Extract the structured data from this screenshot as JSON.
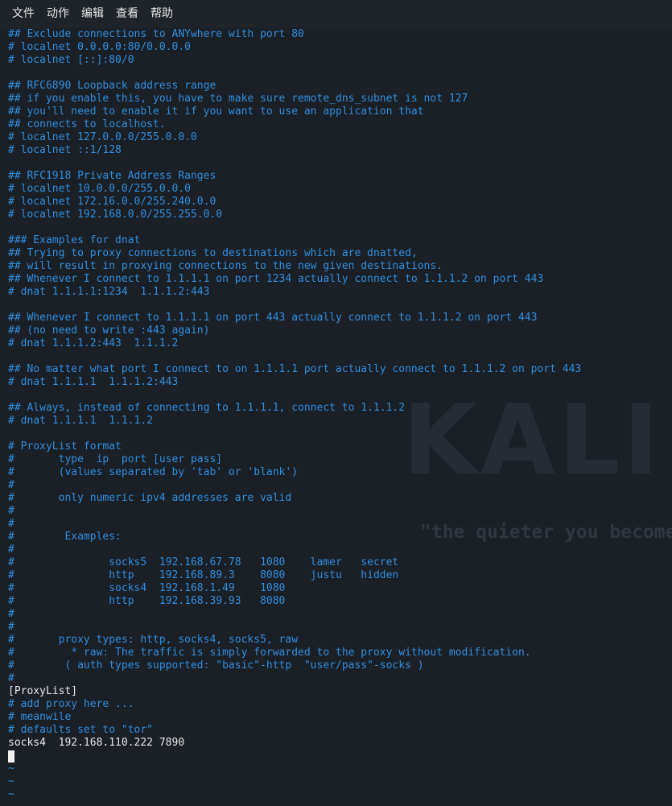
{
  "menu": [
    "文件",
    "动作",
    "编辑",
    "查看",
    "帮助"
  ],
  "wallpaper": {
    "logo_text": "KALI",
    "quote": "\"the quieter you become\""
  },
  "lines": [
    {
      "text": "## Exclude connections to ANYwhere with port 80",
      "style": "comment"
    },
    {
      "text": "# localnet 0.0.0.0:80/0.0.0.0",
      "style": "comment"
    },
    {
      "text": "# localnet [::]:80/0",
      "style": "comment"
    },
    {
      "text": "",
      "style": "comment"
    },
    {
      "text": "## RFC6890 Loopback address range",
      "style": "comment"
    },
    {
      "text": "## if you enable this, you have to make sure remote_dns_subnet is not 127",
      "style": "comment"
    },
    {
      "text": "## you'll need to enable it if you want to use an application that",
      "style": "comment"
    },
    {
      "text": "## connects to localhost.",
      "style": "comment"
    },
    {
      "text": "# localnet 127.0.0.0/255.0.0.0",
      "style": "comment"
    },
    {
      "text": "# localnet ::1/128",
      "style": "comment"
    },
    {
      "text": "",
      "style": "comment"
    },
    {
      "text": "## RFC1918 Private Address Ranges",
      "style": "comment"
    },
    {
      "text": "# localnet 10.0.0.0/255.0.0.0",
      "style": "comment"
    },
    {
      "text": "# localnet 172.16.0.0/255.240.0.0",
      "style": "comment"
    },
    {
      "text": "# localnet 192.168.0.0/255.255.0.0",
      "style": "comment"
    },
    {
      "text": "",
      "style": "comment"
    },
    {
      "text": "### Examples for dnat",
      "style": "comment"
    },
    {
      "text": "## Trying to proxy connections to destinations which are dnatted,",
      "style": "comment"
    },
    {
      "text": "## will result in proxying connections to the new given destinations.",
      "style": "comment"
    },
    {
      "text": "## Whenever I connect to 1.1.1.1 on port 1234 actually connect to 1.1.1.2 on port 443",
      "style": "comment"
    },
    {
      "text": "# dnat 1.1.1.1:1234  1.1.1.2:443",
      "style": "comment"
    },
    {
      "text": "",
      "style": "comment"
    },
    {
      "text": "## Whenever I connect to 1.1.1.1 on port 443 actually connect to 1.1.1.2 on port 443",
      "style": "comment"
    },
    {
      "text": "## (no need to write :443 again)",
      "style": "comment"
    },
    {
      "text": "# dnat 1.1.1.2:443  1.1.1.2",
      "style": "comment"
    },
    {
      "text": "",
      "style": "comment"
    },
    {
      "text": "## No matter what port I connect to on 1.1.1.1 port actually connect to 1.1.1.2 on port 443",
      "style": "comment"
    },
    {
      "text": "# dnat 1.1.1.1  1.1.1.2:443",
      "style": "comment"
    },
    {
      "text": "",
      "style": "comment"
    },
    {
      "text": "## Always, instead of connecting to 1.1.1.1, connect to 1.1.1.2",
      "style": "comment"
    },
    {
      "text": "# dnat 1.1.1.1  1.1.1.2",
      "style": "comment"
    },
    {
      "text": "",
      "style": "comment"
    },
    {
      "text": "# ProxyList format",
      "style": "comment"
    },
    {
      "text": "#       type  ip  port [user pass]",
      "style": "comment"
    },
    {
      "text": "#       (values separated by 'tab' or 'blank')",
      "style": "comment"
    },
    {
      "text": "#",
      "style": "comment"
    },
    {
      "text": "#       only numeric ipv4 addresses are valid",
      "style": "comment"
    },
    {
      "text": "#",
      "style": "comment"
    },
    {
      "text": "#",
      "style": "comment"
    },
    {
      "text": "#        Examples:",
      "style": "comment"
    },
    {
      "text": "#",
      "style": "comment"
    },
    {
      "text": "#               socks5  192.168.67.78   1080    lamer   secret",
      "style": "comment"
    },
    {
      "text": "#               http    192.168.89.3    8080    justu   hidden",
      "style": "comment"
    },
    {
      "text": "#               socks4  192.168.1.49    1080",
      "style": "comment"
    },
    {
      "text": "#               http    192.168.39.93   8080",
      "style": "comment"
    },
    {
      "text": "#",
      "style": "comment"
    },
    {
      "text": "#",
      "style": "comment"
    },
    {
      "text": "#       proxy types: http, socks4, socks5, raw",
      "style": "comment"
    },
    {
      "text": "#         * raw: The traffic is simply forwarded to the proxy without modification.",
      "style": "comment"
    },
    {
      "text": "#        ( auth types supported: \"basic\"-http  \"user/pass\"-socks )",
      "style": "comment"
    },
    {
      "text": "#",
      "style": "comment"
    },
    {
      "text": "[ProxyList]",
      "style": "normal"
    },
    {
      "text": "# add proxy here ...",
      "style": "comment"
    },
    {
      "text": "# meanwile",
      "style": "comment"
    },
    {
      "text": "# defaults set to \"tor\"",
      "style": "comment"
    },
    {
      "text": "socks4  192.168.110.222 7890",
      "style": "normal"
    },
    {
      "text": "",
      "style": "cursor"
    },
    {
      "text": "~",
      "style": "tilde"
    },
    {
      "text": "~",
      "style": "tilde"
    },
    {
      "text": "~",
      "style": "tilde"
    }
  ]
}
